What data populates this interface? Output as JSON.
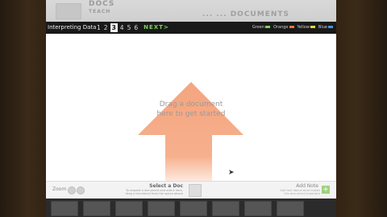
{
  "site": {
    "logo_line1": "DOCS",
    "logo_line2": "TEACH",
    "header_links": "...  ...  DOCUMENTS"
  },
  "toolbar": {
    "title": "Interpreting Data",
    "steps": [
      "1",
      "2",
      "3",
      "4",
      "5",
      "6"
    ],
    "active_step": "3",
    "next_label": "NEXT>",
    "legend": {
      "item1": "Green",
      "item2": "Orange",
      "item3": "Yellow",
      "item4": "Blue",
      "item1_color": "#7fd25a",
      "item2_color": "#e07a3a",
      "item3_color": "#e6d34a",
      "item4_color": "#4a90d9"
    }
  },
  "canvas": {
    "drop_text_line1": "Drag a document",
    "drop_text_line2": "here to get started",
    "arrow_color": "#f4a57e"
  },
  "bottom": {
    "zoom_label": "Zoom",
    "select_title": "Select a Doc",
    "select_sub_line1": "To request a document and add it here,",
    "select_sub_line2": "drag a thumbnail from the space above",
    "add_title": "Add Note",
    "add_sub_line1": "Add text about what makes",
    "add_sub_line2": "this document important",
    "add_button": "+"
  }
}
